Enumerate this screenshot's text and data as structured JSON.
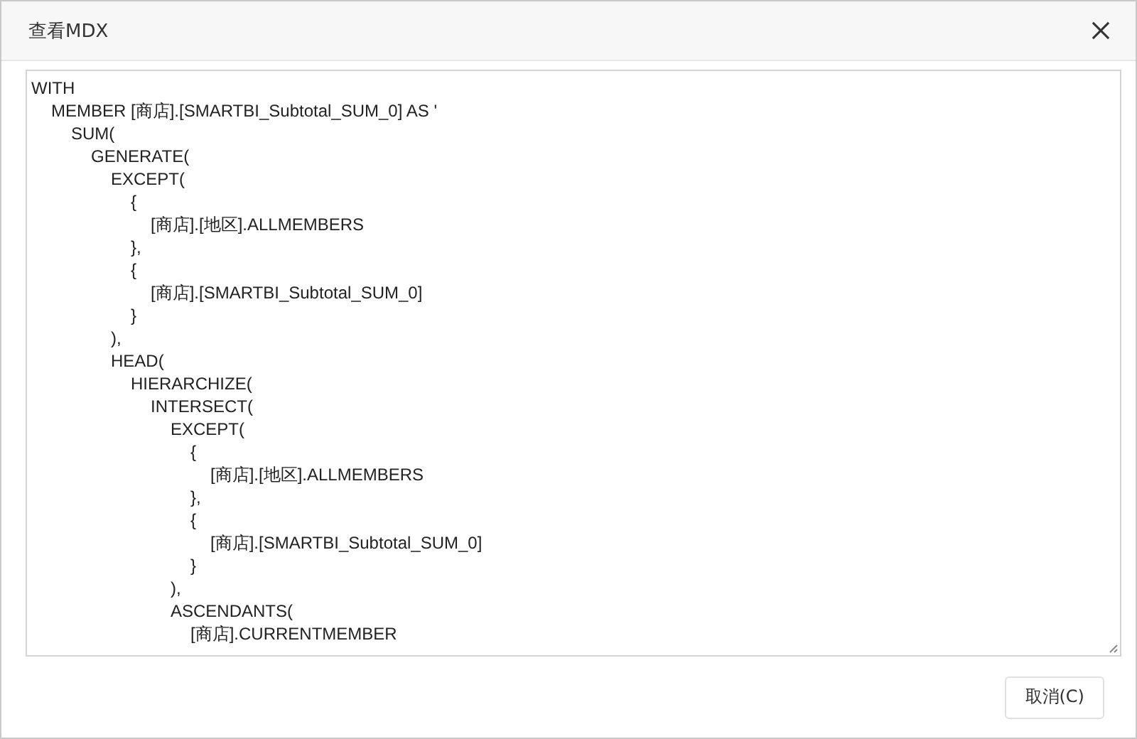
{
  "dialog": {
    "title": "查看MDX"
  },
  "code_lines": [
    {
      "text": "WITH",
      "children": [
        {
          "text": "MEMBER [商店].[SMARTBI_Subtotal_SUM_0] AS '",
          "children": [
            {
              "text": "SUM(",
              "children": [
                {
                  "text": "GENERATE(",
                  "children": [
                    {
                      "text": "EXCEPT(",
                      "children": [
                        {
                          "text": "{",
                          "children": [
                            {
                              "text": "[商店].[地区].ALLMEMBERS"
                            }
                          ]
                        },
                        {
                          "text": "},"
                        },
                        {
                          "text": "{",
                          "children": [
                            {
                              "text": "[商店].[SMARTBI_Subtotal_SUM_0]"
                            }
                          ]
                        },
                        {
                          "text": "}"
                        }
                      ]
                    },
                    {
                      "text": "),"
                    },
                    {
                      "text": "HEAD(",
                      "children": [
                        {
                          "text": "HIERARCHIZE(",
                          "children": [
                            {
                              "text": "INTERSECT(",
                              "children": [
                                {
                                  "text": "EXCEPT(",
                                  "children": [
                                    {
                                      "text": "{",
                                      "children": [
                                        {
                                          "text": "[商店].[地区].ALLMEMBERS"
                                        }
                                      ]
                                    },
                                    {
                                      "text": "},"
                                    },
                                    {
                                      "text": "{",
                                      "children": [
                                        {
                                          "text": "[商店].[SMARTBI_Subtotal_SUM_0]"
                                        }
                                      ]
                                    },
                                    {
                                      "text": "}"
                                    }
                                  ]
                                },
                                {
                                  "text": "),"
                                },
                                {
                                  "text": "ASCENDANTS(",
                                  "children": [
                                    {
                                      "text": "[商店].CURRENTMEMBER"
                                    }
                                  ]
                                }
                              ]
                            }
                          ]
                        }
                      ]
                    }
                  ]
                }
              ]
            }
          ]
        }
      ]
    }
  ],
  "buttons": [
    {
      "label": "取消(C)"
    }
  ]
}
